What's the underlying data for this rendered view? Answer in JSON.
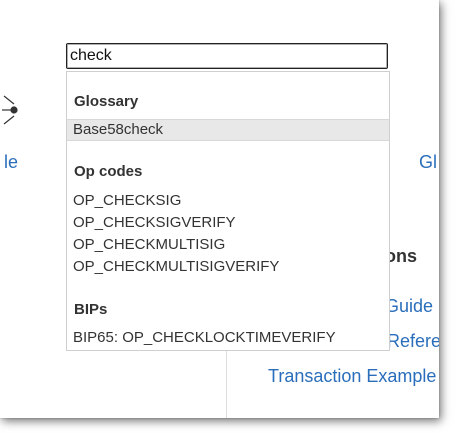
{
  "search": {
    "value": "check"
  },
  "background": {
    "left_link": "le",
    "right_link": "Gl",
    "heading": "ions",
    "links": [
      "Guide",
      "Refere",
      "Transaction Example"
    ]
  },
  "dropdown": {
    "sections": [
      {
        "title": "Glossary",
        "items": [
          "Base58check"
        ],
        "highlighted_index": 0
      },
      {
        "title": "Op codes",
        "items": [
          "OP_CHECKSIG",
          "OP_CHECKSIGVERIFY",
          "OP_CHECKMULTISIG",
          "OP_CHECKMULTISIGVERIFY"
        ]
      },
      {
        "title": "BIPs",
        "items": [
          "BIP65: OP_CHECKLOCKTIMEVERIFY"
        ]
      }
    ]
  },
  "colors": {
    "link": "#2a6ebb",
    "highlight": "#e8e8e8",
    "text": "#333333"
  }
}
